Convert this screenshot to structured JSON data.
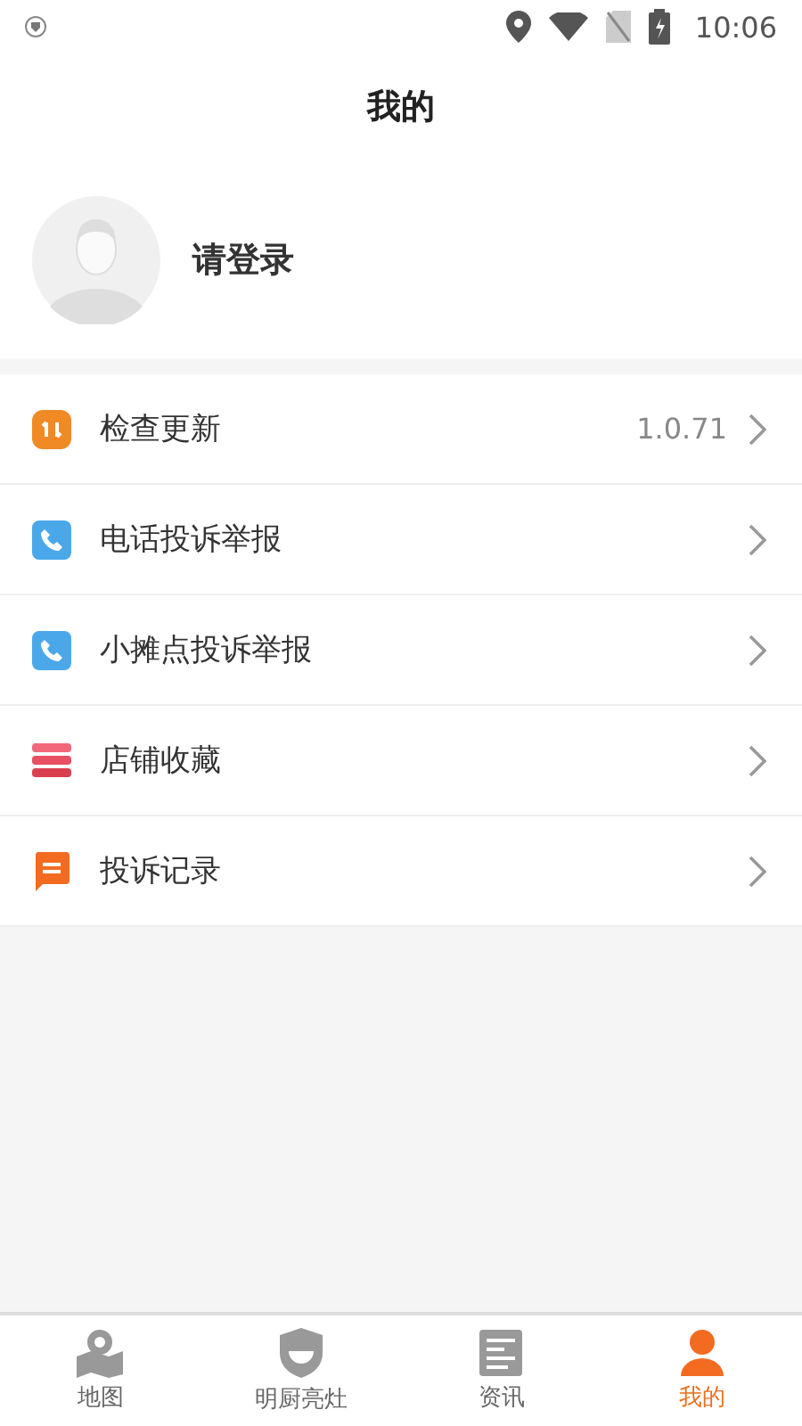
{
  "status_bar": {
    "time": "10:06"
  },
  "header": {
    "title": "我的"
  },
  "profile": {
    "name": "请登录"
  },
  "menu": [
    {
      "kind": "update",
      "label": "检查更新",
      "value": "1.0.71"
    },
    {
      "kind": "phone",
      "label": "电话投诉举报"
    },
    {
      "kind": "phone",
      "label": "小摊点投诉举报"
    },
    {
      "kind": "stack",
      "label": "店铺收藏"
    },
    {
      "kind": "message",
      "label": "投诉记录"
    }
  ],
  "tabs": [
    {
      "kind": "map",
      "label": "地图",
      "selected": false
    },
    {
      "kind": "shield",
      "label": "明厨亮灶",
      "selected": false
    },
    {
      "kind": "news",
      "label": "资讯",
      "selected": false
    },
    {
      "kind": "user",
      "label": "我的",
      "selected": true
    }
  ]
}
